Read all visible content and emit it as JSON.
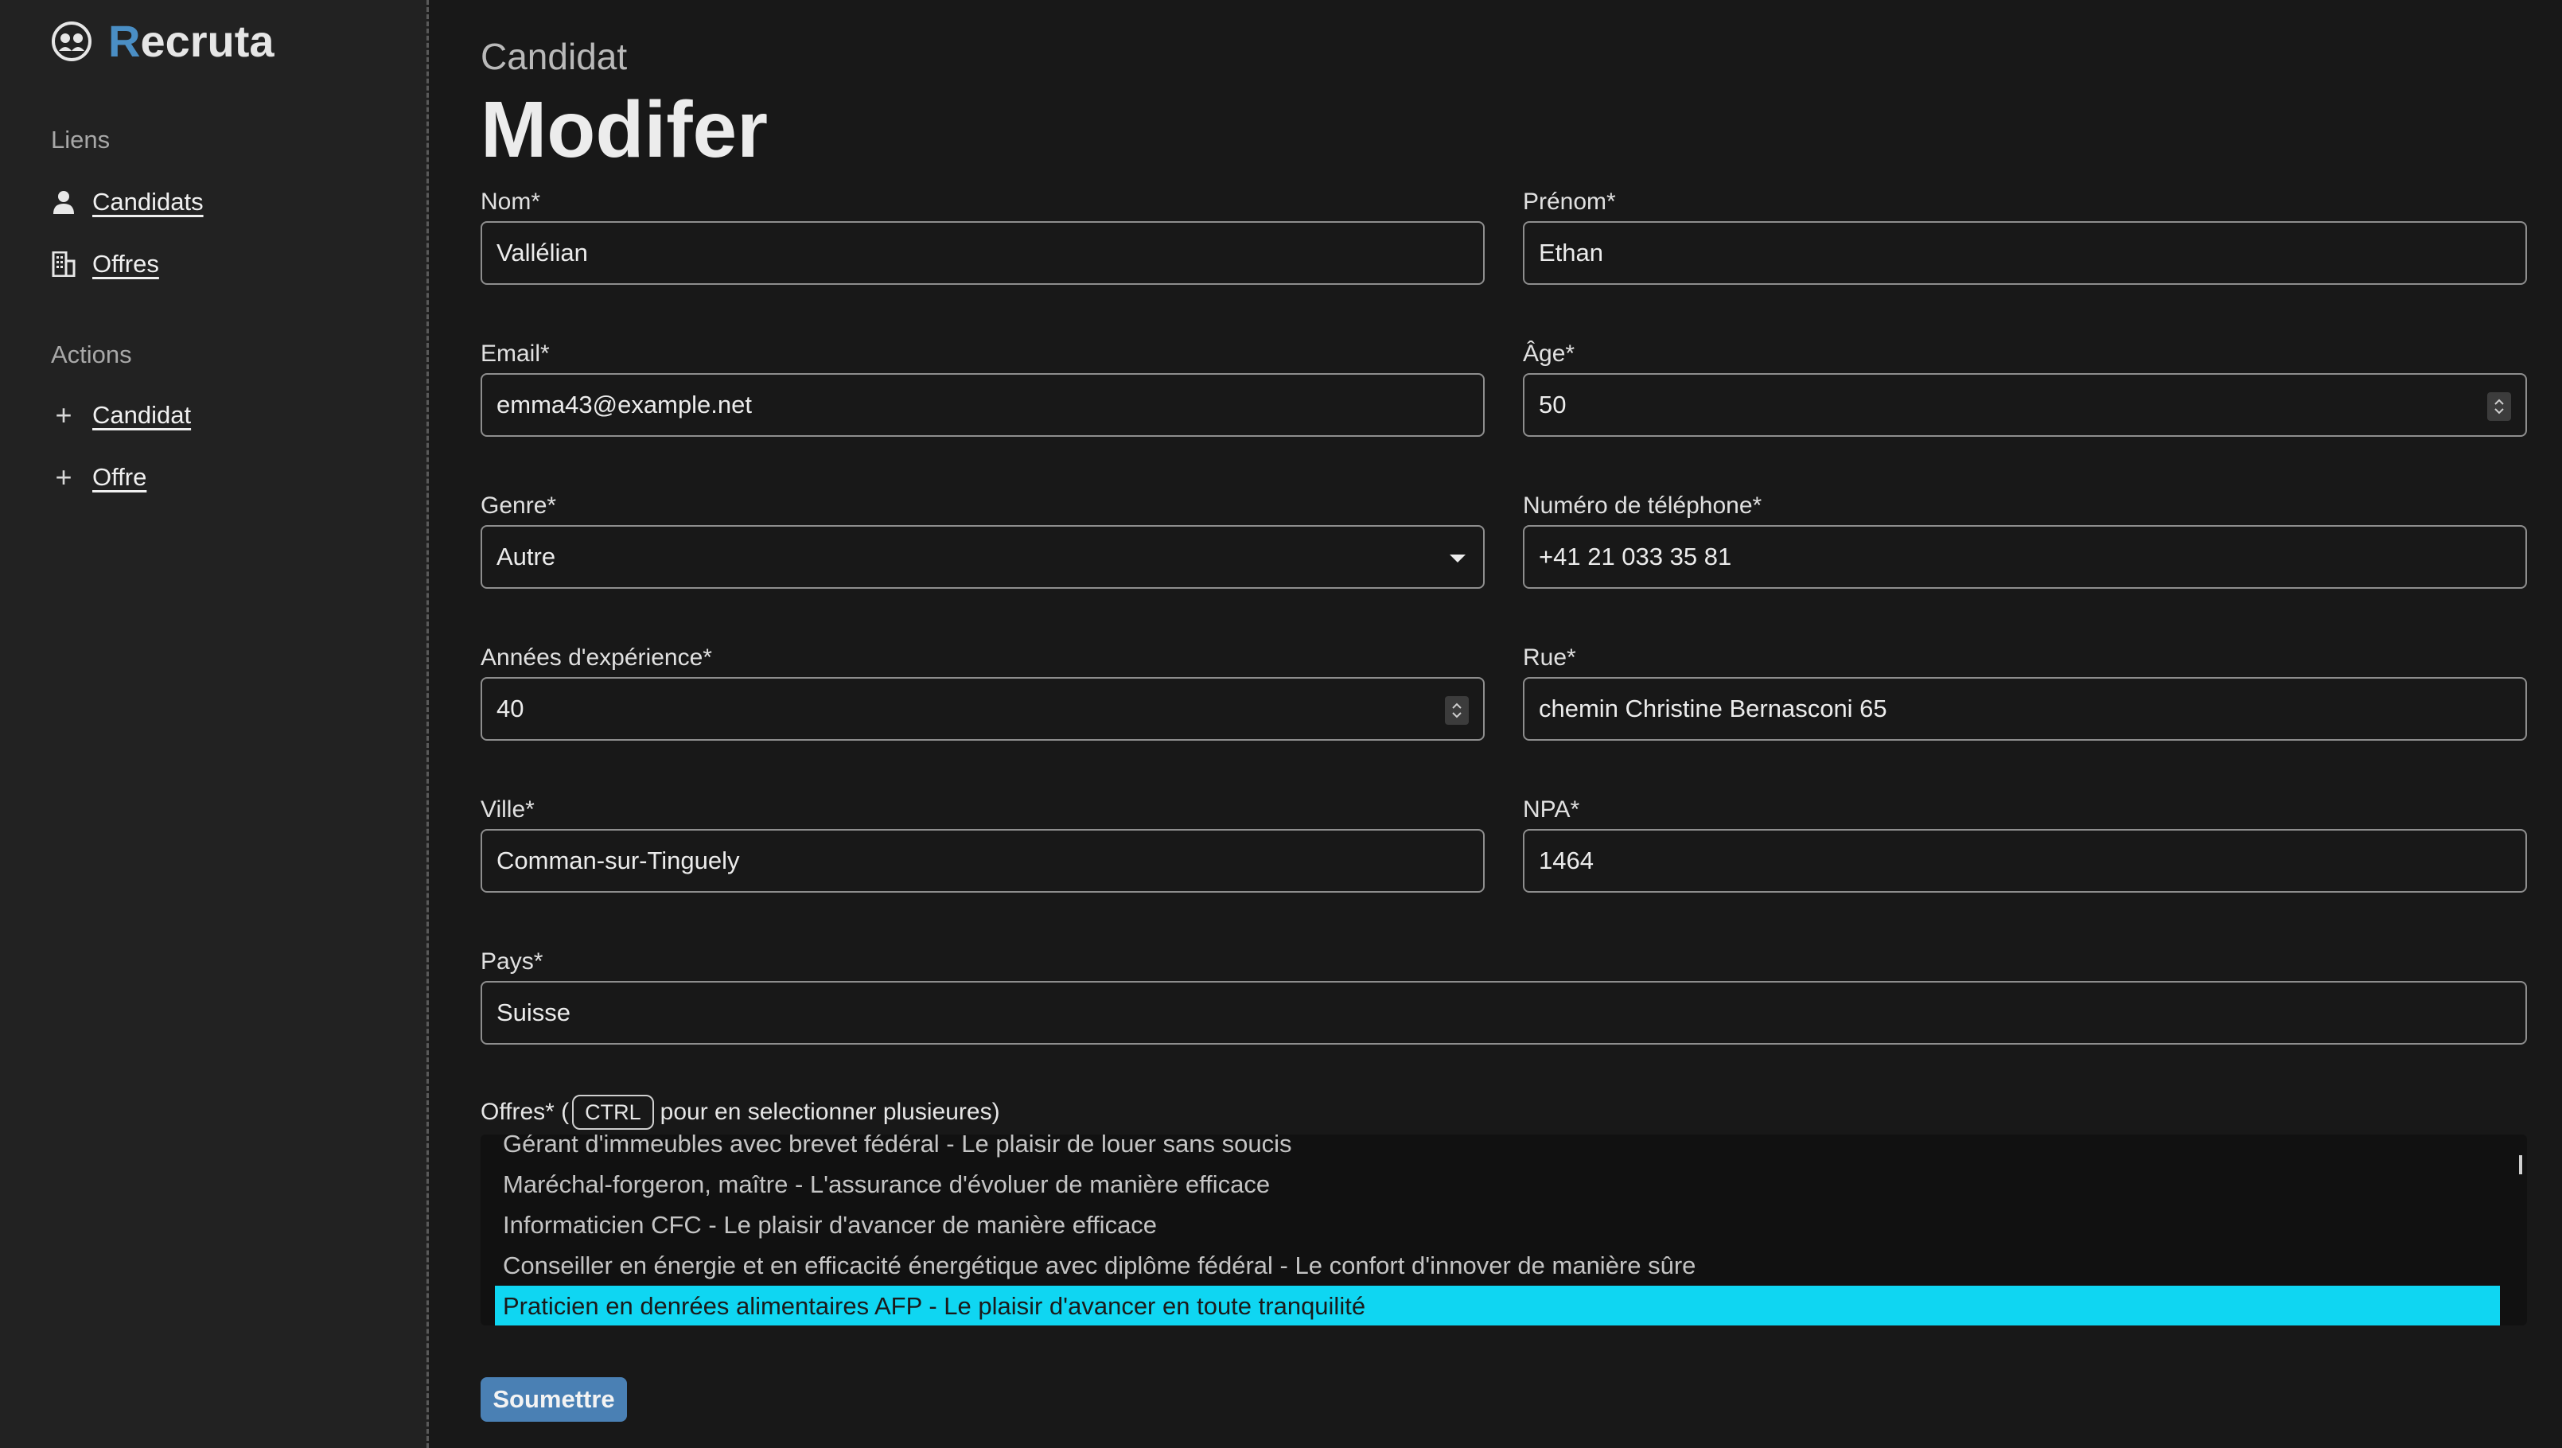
{
  "app": {
    "name_first": "R",
    "name_rest": "ecruta",
    "logo_icon": "users-circle-icon"
  },
  "sidebar": {
    "links_title": "Liens",
    "links": [
      {
        "label": "Candidats",
        "icon": "user-icon"
      },
      {
        "label": "Offres",
        "icon": "building-icon"
      }
    ],
    "actions_title": "Actions",
    "actions": [
      {
        "label": "Candidat",
        "icon": "plus-icon"
      },
      {
        "label": "Offre",
        "icon": "plus-icon"
      }
    ]
  },
  "page": {
    "subtitle": "Candidat",
    "title": "Modifer"
  },
  "form": {
    "nom": {
      "label": "Nom*",
      "value": "Vallélian"
    },
    "prenom": {
      "label": "Prénom*",
      "value": "Ethan"
    },
    "email": {
      "label": "Email*",
      "value": "emma43@example.net"
    },
    "age": {
      "label": "Âge*",
      "value": "50"
    },
    "genre": {
      "label": "Genre*",
      "value": "Autre"
    },
    "telephone": {
      "label": "Numéro de téléphone*",
      "value": "+41 21 033 35 81"
    },
    "experience": {
      "label": "Années d'expérience*",
      "value": "40"
    },
    "rue": {
      "label": "Rue*",
      "value": "chemin Christine Bernasconi 65"
    },
    "ville": {
      "label": "Ville*",
      "value": "Comman-sur-Tinguely"
    },
    "npa": {
      "label": "NPA*",
      "value": "1464"
    },
    "pays": {
      "label": "Pays*",
      "value": "Suisse"
    },
    "offres": {
      "label_prefix": "Offres* (",
      "kbd": "CTRL",
      "label_suffix": "pour en selectionner plusieures)",
      "options": [
        "Gérant d'immeubles avec brevet fédéral - Le plaisir de louer sans soucis",
        "Maréchal-forgeron, maître - L'assurance d'évoluer de manière efficace",
        "Informaticien CFC - Le plaisir d'avancer de manière efficace",
        "Conseiller en énergie et en efficacité énergétique avec diplôme fédéral - Le confort d'innover de manière sûre",
        "Praticien en denrées alimentaires AFP - Le plaisir d'avancer en toute tranquilité"
      ],
      "selected": "Praticien en denrées alimentaires AFP - Le plaisir d'avancer en toute tranquilité"
    },
    "submit_label": "Soumettre"
  },
  "colors": {
    "accent": "#4a8ec4",
    "selected_option": "#0fd6f2",
    "submit": "#4a80b4"
  }
}
